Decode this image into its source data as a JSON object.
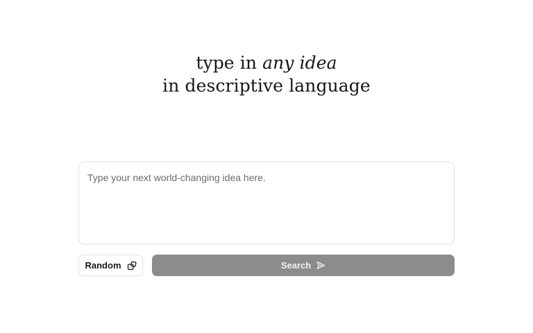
{
  "hero": {
    "line1_prefix": "type in ",
    "line1_emphasis": "any idea",
    "line2": "in descriptive language"
  },
  "idea_input": {
    "placeholder": "Type your next world-changing idea here.",
    "value": ""
  },
  "actions": {
    "random_label": "Random",
    "random_icon": "dice-icon",
    "search_label": "Search",
    "search_icon": "send-icon",
    "search_bg": "#8c8c8e"
  }
}
